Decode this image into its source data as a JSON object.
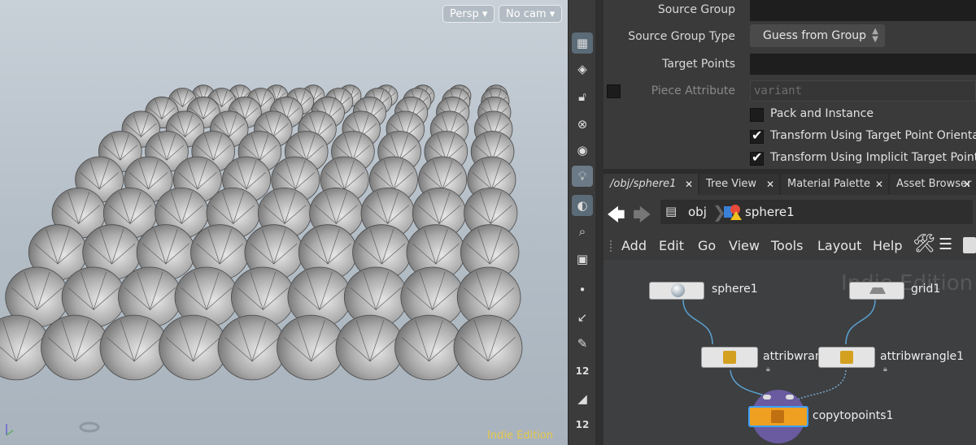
{
  "viewport": {
    "persp_label": "Persp ▾",
    "cam_label": "No cam ▾",
    "watermark": "Indie Edition"
  },
  "toolbar": {
    "icons": [
      "display-options-icon",
      "snap-icon",
      "lock-icon",
      "ghost-icon",
      "view-icon",
      "light-icon",
      "render-icon",
      "camera-icon",
      "camera-alt-icon",
      "dot-icon",
      "brush-icon",
      "pen-icon",
      "point-size-icon",
      "dimension-icon",
      "point-size-icon-2"
    ],
    "point_size_1": "12",
    "point_size_2": "12"
  },
  "params": {
    "source_group_label": "Source Group",
    "source_group_type_label": "Source Group Type",
    "source_group_type_value": "Guess from Group",
    "target_points_label": "Target Points",
    "piece_attribute_label": "Piece Attribute",
    "piece_attribute_value": "variant",
    "pack_instance_label": "Pack and Instance",
    "orient_label": "Transform Using Target Point Orientatio",
    "implicit_label": "Transform Using Implicit Target Point N"
  },
  "tabs": [
    {
      "label": "/obj/sphere1"
    },
    {
      "label": "Tree View"
    },
    {
      "label": "Material Palette"
    },
    {
      "label": "Asset Browser"
    }
  ],
  "path": {
    "obj": "obj",
    "node": "sphere1"
  },
  "menu": [
    "Add",
    "Edit",
    "Go",
    "View",
    "Tools",
    "Layout",
    "Help"
  ],
  "network": {
    "watermark": "Indie Edition",
    "nodes": {
      "sphere": "sphere1",
      "grid": "grid1",
      "wrangle_a": "attribwran",
      "wrangle_b": "attribwrangle1",
      "copy": "copytopoints1"
    }
  },
  "colors": {
    "accent_orange": "#f0a020",
    "node_blue": "#3da0ff",
    "wire": "#5aa0d0",
    "indie_yellow": "#e6c84a"
  }
}
